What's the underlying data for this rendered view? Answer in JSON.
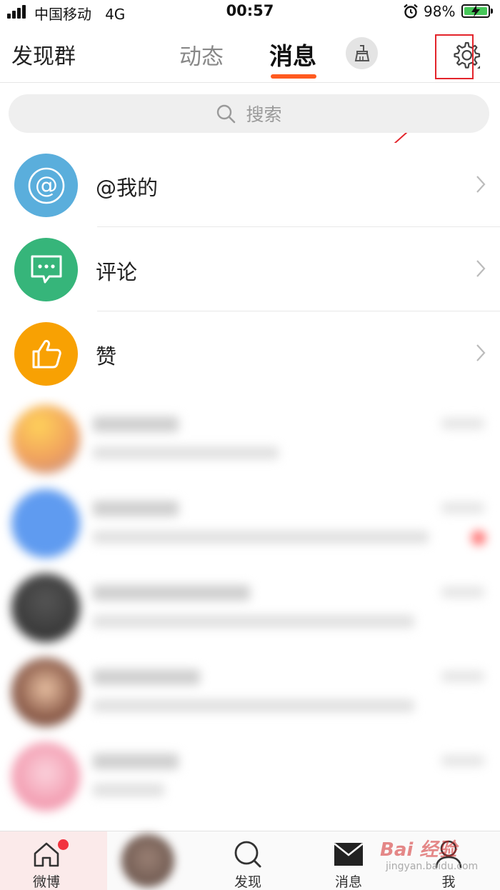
{
  "status_bar": {
    "carrier": "中国移动",
    "network": "4G",
    "time": "00:57",
    "battery": "98%"
  },
  "header": {
    "left_label": "发现群",
    "tabs": [
      "动态",
      "消息"
    ],
    "active_tab": "消息",
    "accent_color": "#ff5a1f"
  },
  "search": {
    "placeholder": "搜索"
  },
  "fixed_rows": [
    {
      "title": "@我的",
      "icon": "at-icon",
      "color": "#5aaedc"
    },
    {
      "title": "评论",
      "icon": "comment-icon",
      "color": "#36b57a"
    },
    {
      "title": "赞",
      "icon": "thumbs-up-icon",
      "color": "#f8a103"
    }
  ],
  "tab_bar": {
    "items": [
      {
        "label": "微博",
        "icon": "home-icon"
      },
      {
        "label": "发现",
        "icon": "search-icon"
      },
      {
        "label": "消息",
        "icon": "mail-icon"
      },
      {
        "label": "我",
        "icon": "person-icon"
      }
    ]
  },
  "watermark": {
    "text": "Bai 经验",
    "sub": "jingyan.baidu.com"
  }
}
